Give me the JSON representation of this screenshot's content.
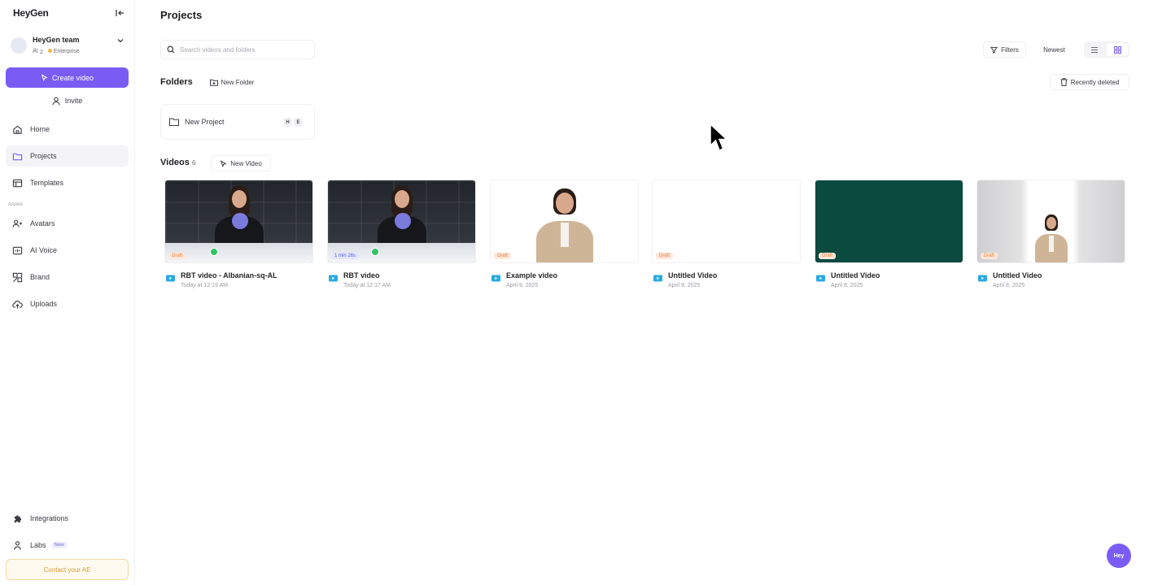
{
  "app": {
    "logo": "HeyGen"
  },
  "team": {
    "name": "HeyGen team",
    "members": "2",
    "plan": "Enterprise"
  },
  "sidebar": {
    "create_label": "Create video",
    "invite_label": "Invite",
    "items": [
      {
        "label": "Home"
      },
      {
        "label": "Projects"
      },
      {
        "label": "Templates"
      }
    ],
    "assets_label": "Assets",
    "asset_items": [
      {
        "label": "Avatars"
      },
      {
        "label": "AI Voice"
      },
      {
        "label": "Brand"
      },
      {
        "label": "Uploads"
      }
    ],
    "bottom_items": [
      {
        "label": "Integrations"
      },
      {
        "label": "Labs",
        "badge": "New"
      }
    ],
    "contact_label": "Contact your AE"
  },
  "main": {
    "title": "Projects",
    "search_placeholder": "Search videos and folders",
    "filters_label": "Filters",
    "sort_label": "Newest",
    "folders_title": "Folders",
    "new_folder_label": "New Folder",
    "recently_deleted_label": "Recently deleted",
    "folders": [
      {
        "name": "New Project",
        "initials": [
          "H",
          "E"
        ]
      }
    ],
    "videos_title": "Videos",
    "videos_count": "6",
    "new_video_label": "New Video",
    "videos": [
      {
        "title": "RBT video - Albanian-sq-AL",
        "date": "Today at 12:19 AM",
        "badge": "Draft"
      },
      {
        "title": "RBT video",
        "date": "Today at 12:17 AM",
        "badge": "1 min 26s"
      },
      {
        "title": "Example video",
        "date": "April 9, 2025",
        "badge": "Draft"
      },
      {
        "title": "Untitled Video",
        "date": "April 9, 2025",
        "badge": "Draft"
      },
      {
        "title": "Untitled Video",
        "date": "April 8, 2025",
        "badge": "Draft"
      },
      {
        "title": "Untitled Video",
        "date": "April 8, 2025",
        "badge": "Draft"
      }
    ]
  },
  "fab_label": "Hey",
  "colors": {
    "accent": "#7a5cf5",
    "draft": "#e97b3b",
    "success": "#32c266",
    "teal_bg": "#0a4a3f"
  }
}
